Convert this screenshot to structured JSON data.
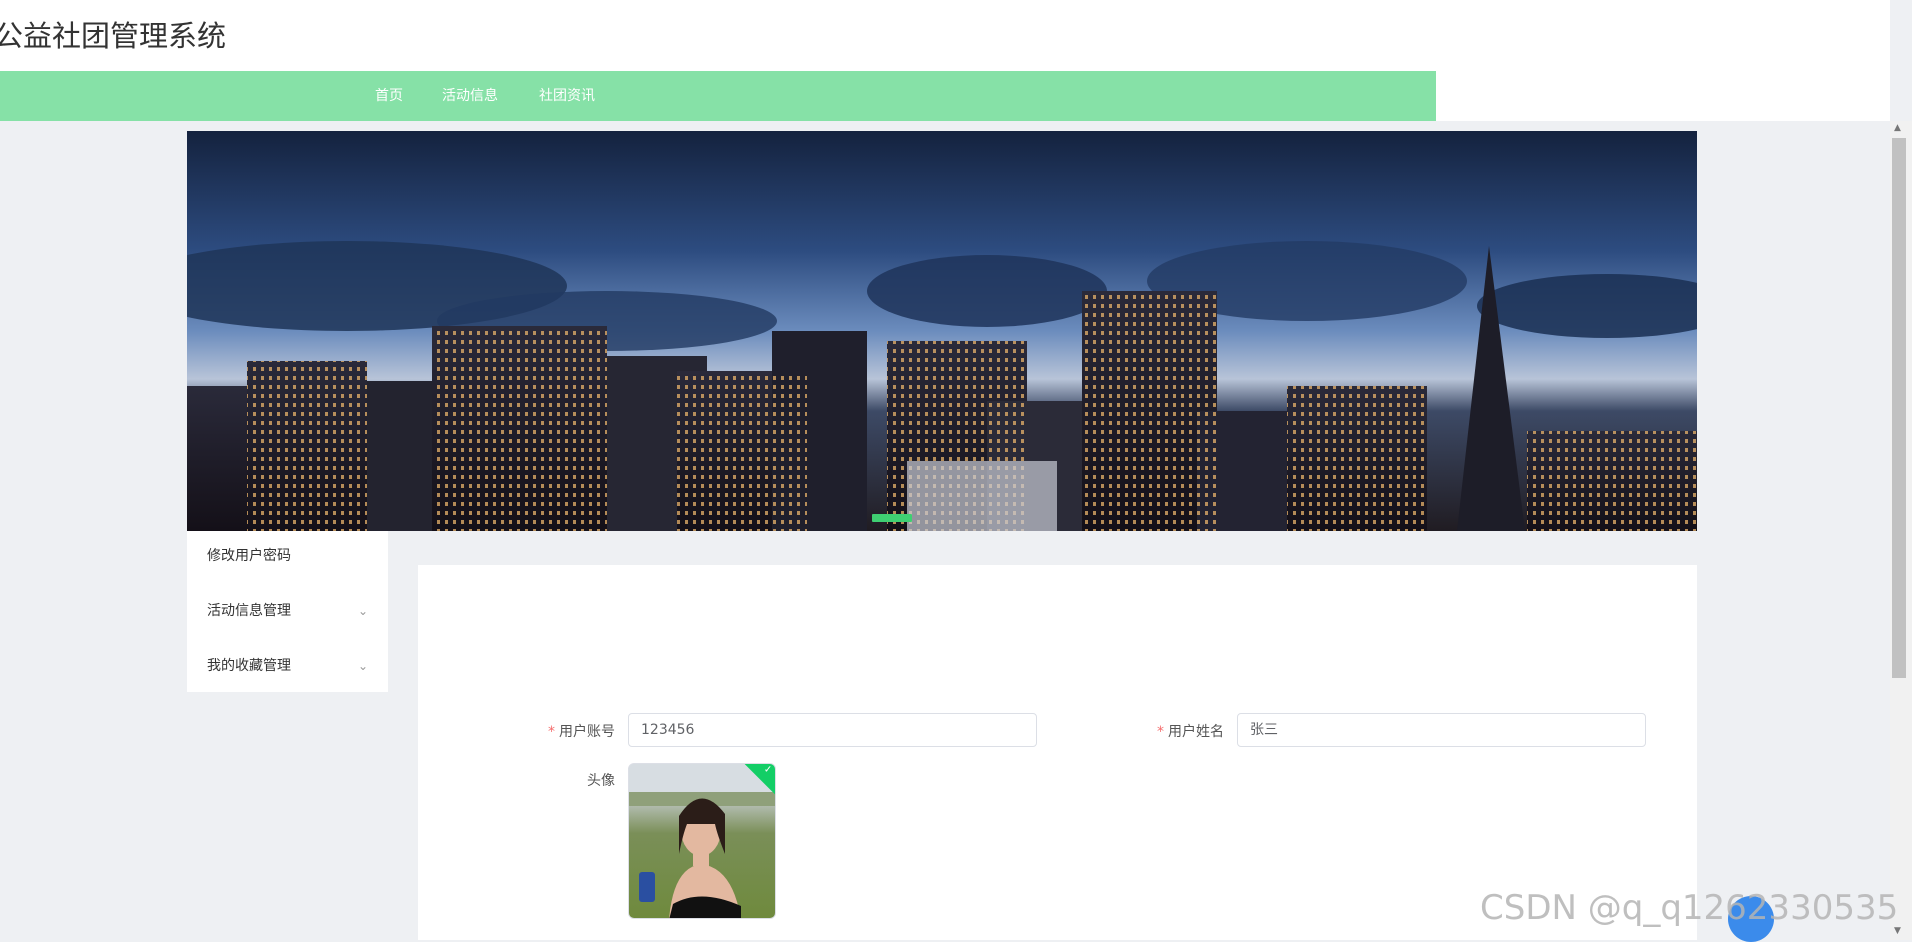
{
  "site": {
    "title": "公益社团管理系统"
  },
  "nav": {
    "items": [
      {
        "label": "首页"
      },
      {
        "label": "活动信息"
      },
      {
        "label": "社团资讯"
      }
    ]
  },
  "sidebar": {
    "items": [
      {
        "label": "修改用户密码",
        "has_submenu": false
      },
      {
        "label": "活动信息管理",
        "has_submenu": true
      },
      {
        "label": "我的收藏管理",
        "has_submenu": true
      }
    ]
  },
  "form": {
    "account": {
      "label": "用户账号",
      "value": "123456",
      "required": true
    },
    "name": {
      "label": "用户姓名",
      "value": "张三",
      "required": true
    },
    "avatar": {
      "label": "头像"
    }
  },
  "watermark": {
    "text": "CSDN @q_q1262330535"
  },
  "colors": {
    "nav_bg": "#86e1a7",
    "carousel_active": "#3fcf72",
    "required": "#f56c6c",
    "upload_success": "#13ce66"
  }
}
